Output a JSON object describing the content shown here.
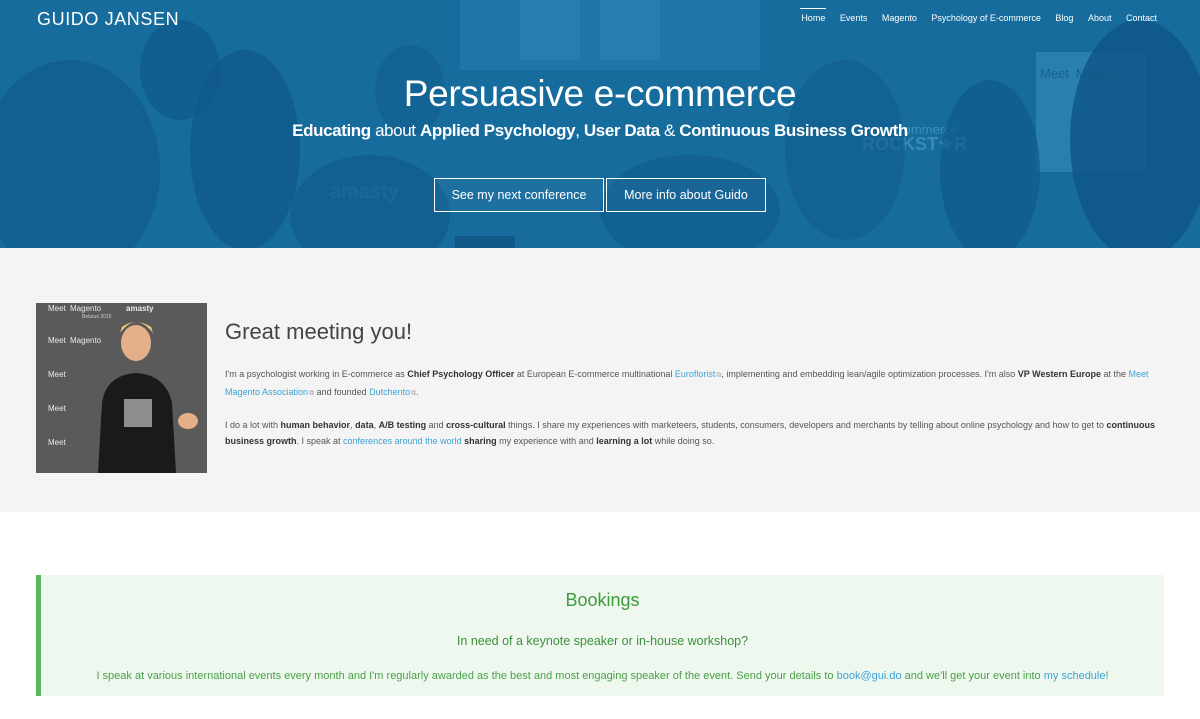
{
  "site": {
    "logo": "GUIDO JANSEN",
    "nav": [
      {
        "label": "Home",
        "active": true
      },
      {
        "label": "Events"
      },
      {
        "label": "Magento"
      },
      {
        "label": "Psychology of E-commerce"
      },
      {
        "label": "Blog"
      },
      {
        "label": "About"
      },
      {
        "label": "Contact"
      }
    ]
  },
  "hero": {
    "title": "Persuasive e-commerce",
    "subtitle": {
      "p1": "Educating",
      "p2": " about ",
      "p3": "Applied Psychology",
      "p4": ", ",
      "p5": "User Data",
      "p6": " & ",
      "p7": "Continuous Business Growth"
    },
    "buttons": {
      "conference": "See my next conference",
      "info": "More info about Guido"
    },
    "photo_text": {
      "meet": "Meet",
      "magento": "Magento",
      "amasty": "amasty",
      "rockstar": "ROCKST★R",
      "ecommerce": "eCommerce"
    }
  },
  "intro": {
    "heading": "Great meeting you!",
    "portrait_banner": {
      "meet": "Meet",
      "magento": "Magento",
      "belarus": "Belarus 2015",
      "amasty": "amasty"
    },
    "p1": {
      "t1": "I'm a psychologist working in E-commerce as ",
      "b1": "Chief Psychology Officer",
      "t2": " at European E-commerce multinational ",
      "l1": "Euroflorist",
      "t3": ", implementing and embedding lean/agile optimization processes. I'm also ",
      "b2": "VP Western Europe",
      "t4": " at the ",
      "l2": "Meet Magento Association",
      "t5": " and founded ",
      "l3": "Dutchento",
      "t6": "."
    },
    "p2": {
      "t1": "I do a lot with ",
      "b1": "human behavior",
      "t2": ", ",
      "b2": "data",
      "t3": ", ",
      "b3": "A/B testing",
      "t4": " and ",
      "b4": "cross-cultural",
      "t5": " things. I share my experiences with marketeers, students, consumers, developers and merchants by telling about online psychology and how to get to ",
      "b5": "continuous business growth",
      "t6": ". I speak at ",
      "l1": "conferences around the world",
      "t7": " ",
      "b6": "sharing",
      "t8": " my experience with and ",
      "b7": "learning a lot",
      "t9": " while doing so."
    }
  },
  "bookings": {
    "title": "Bookings",
    "subtitle": "In need of a keynote speaker or in-house workshop?",
    "t1": "I speak at various international events every month and I'm regularly awarded as the best and most engaging speaker of the event. Send your details to ",
    "email": "book@gui.do",
    "t2": " and we'll get your event into ",
    "schedule": "my schedule",
    "t3": "!"
  },
  "colors": {
    "hero_blue": "#1a77aa",
    "link": "#3aa3d8",
    "booking_green": "#5cb85c",
    "booking_bg": "#eff8ee"
  }
}
